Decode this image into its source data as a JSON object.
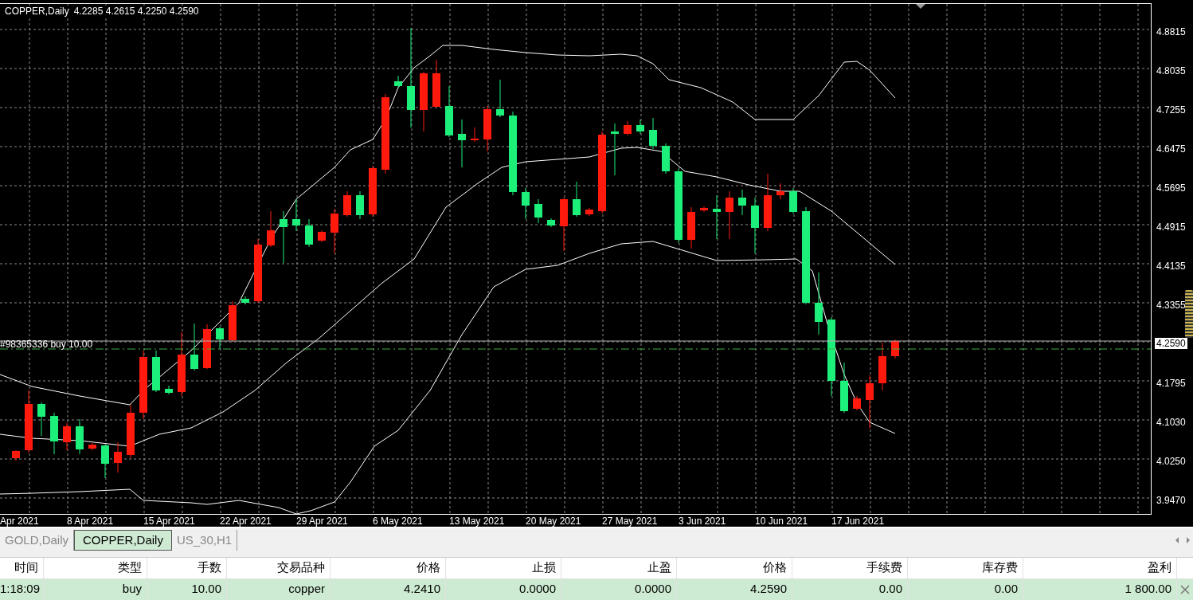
{
  "chart": {
    "symbol": "COPPER,Daily",
    "ohlc": "4.2285 4.2615 4.2250 4.2590",
    "order_label": "#98365336 buy 10.00",
    "current_price": "4.2590",
    "price_ticks": [
      "4.8815",
      "4.8035",
      "4.7255",
      "4.6475",
      "4.5695",
      "4.4915",
      "4.4135",
      "4.3355",
      "4.1795",
      "4.1030",
      "4.0250",
      "3.9470"
    ],
    "date_labels": [
      "Apr 2021",
      "8 Apr 2021",
      "15 Apr 2021",
      "22 Apr 2021",
      "29 Apr 2021",
      "6 May 2021",
      "13 May 2021",
      "20 May 2021",
      "27 May 2021",
      "3 Jun 2021",
      "10 Jun 2021",
      "17 Jun 2021"
    ]
  },
  "tabs": [
    {
      "label": "GOLD,Daily",
      "selected": false
    },
    {
      "label": "COPPER,Daily",
      "selected": true
    },
    {
      "label": "US_30,H1",
      "selected": false
    }
  ],
  "trades": {
    "columns": [
      "时间",
      "类型",
      "手数",
      "交易品种",
      "价格",
      "止损",
      "止盈",
      "价格",
      "手续费",
      "库存费",
      "盈利"
    ],
    "rows": [
      {
        "cells": [
          "1:18:09",
          "buy",
          "10.00",
          "copper",
          "4.2410",
          "0.0000",
          "0.0000",
          "4.2590",
          "0.00",
          "0.00",
          "1 800.00"
        ]
      }
    ]
  }
}
